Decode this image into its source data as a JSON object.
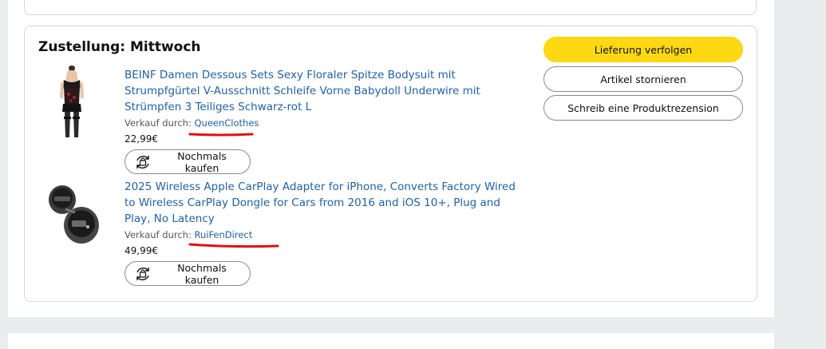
{
  "delivery": {
    "heading": "Zustellung: Mittwoch"
  },
  "actions": {
    "track": "Lieferung verfolgen",
    "cancel": "Artikel stornieren",
    "review": "Schreib eine Produktrezension"
  },
  "items": [
    {
      "title": "BEINF Damen Dessous Sets Sexy Floraler Spitze Bodysuit mit Strumpfgürtel V-Ausschnitt Schleife Vorne Babydoll Underwire mit Strümpfen 3 Teiliges Schwarz-rot L",
      "sold_by_label": "Verkauf durch:",
      "seller": "QueenClothes",
      "price": "22,99€",
      "buy_again": "Nochmals kaufen",
      "image_icon": "lingerie-product-image"
    },
    {
      "title": "2025 Wireless Apple CarPlay Adapter for iPhone, Converts Factory Wired to Wireless CarPlay Dongle for Cars from 2016 and iOS 10+, Plug and Play, No Latency",
      "sold_by_label": "Verkauf durch:",
      "seller": "RuiFenDirect",
      "price": "49,99€",
      "buy_again": "Nochmals kaufen",
      "image_icon": "carplay-dongle-product-image"
    }
  ],
  "colors": {
    "link": "#2162a1",
    "primary_button": "#ffd814",
    "annotation": "#e01010"
  }
}
